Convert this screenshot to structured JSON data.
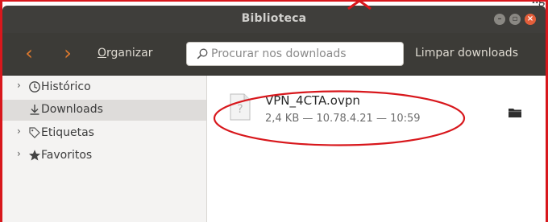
{
  "annotation": {
    "note": "ng"
  },
  "window": {
    "title": "Biblioteca",
    "controls": [
      "minimize",
      "maximize",
      "close"
    ]
  },
  "toolbar": {
    "back_icon": "chevron-left-icon",
    "forward_icon": "chevron-right-icon",
    "organize_accel": "O",
    "organize_rest": "rganizar",
    "search": {
      "placeholder": "Procurar nos downloads",
      "value": ""
    },
    "clear_label": "Limpar downloads"
  },
  "sidebar": {
    "items": [
      {
        "label": "Histórico",
        "icon": "clock-icon",
        "expander": "›",
        "selected": false
      },
      {
        "label": "Downloads",
        "icon": "download-arrow-icon",
        "expander": "",
        "selected": true
      },
      {
        "label": "Etiquetas",
        "icon": "tag-icon",
        "expander": "›",
        "selected": false
      },
      {
        "label": "Favoritos",
        "icon": "star-icon",
        "expander": "›",
        "selected": false
      }
    ]
  },
  "downloads": [
    {
      "name": "VPN_4CTA.ovpn",
      "meta": "2,4 KB — 10.78.4.21 — 10:59",
      "icon": "unknown-file-icon",
      "action_icon": "folder-icon"
    }
  ],
  "colors": {
    "titlebar": "#3f3e3b",
    "toolbar": "#3c3b37",
    "nav_arrow": "#e07a2d",
    "close_button": "#e35e3a",
    "annotation_red": "#d8171c",
    "sidebar_bg": "#f4f3f2",
    "sidebar_selected": "#dedcda"
  }
}
